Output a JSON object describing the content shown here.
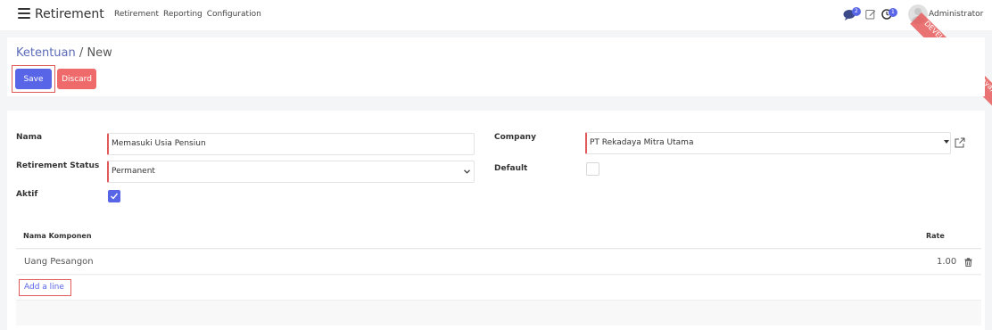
{
  "navbar": {
    "app_title": "Retirement",
    "menu_items": [
      "Retirement",
      "Reporting",
      "Configuration"
    ],
    "chat_count": "2",
    "activity_count": "1",
    "user_name": "Administrator",
    "ribbon_text": "DEVELOPMENT (Rekadaya)"
  },
  "breadcrumb": {
    "parent": "Ketentuan",
    "separator": "/",
    "current": "New"
  },
  "buttons": {
    "save": "Save",
    "discard": "Discard"
  },
  "form": {
    "nama_label": "Nama",
    "nama_value": "Memasuki Usia Pensiun",
    "retirement_status_label": "Retirement Status",
    "retirement_status_value": "Permanent",
    "aktif_label": "Aktif",
    "aktif_checked": true,
    "company_label": "Company",
    "company_value": "PT Rekadaya Mitra Utama",
    "default_label": "Default",
    "default_checked": false
  },
  "table": {
    "columns": [
      "Nama Komponen",
      "Rate"
    ],
    "rows": [
      {
        "nama_komponen": "Uang Pesangon",
        "rate": "1.00"
      }
    ],
    "add_line": "Add a line"
  },
  "colors": {
    "primary": "#5865e6",
    "danger": "#ef6b6b",
    "link": "#5b6bb8",
    "highlight_outline": "#e05a5a"
  },
  "icons": [
    "menu-icon",
    "chat-icon",
    "edit-icon",
    "clock-icon",
    "avatar-icon",
    "external-link-icon",
    "check-icon",
    "trash-icon",
    "caret-down-icon"
  ]
}
